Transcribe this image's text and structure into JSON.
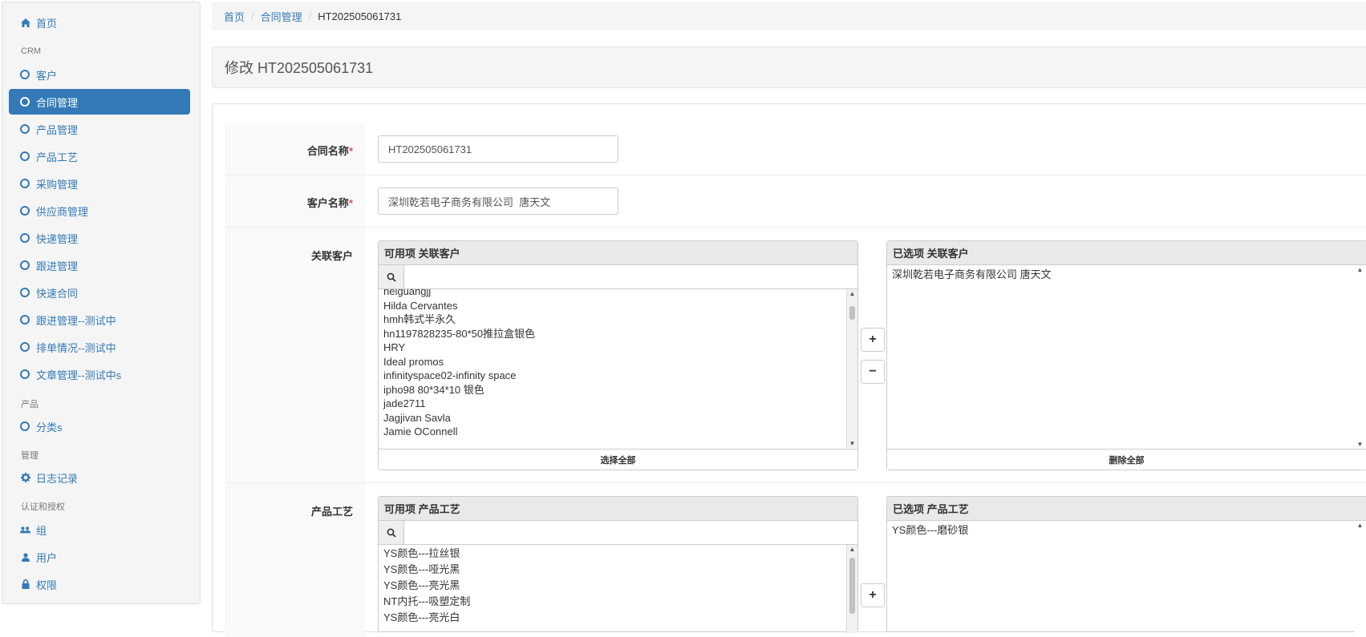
{
  "sidebar": {
    "items": [
      {
        "label": "首页",
        "icon": "home-icon"
      },
      {
        "label": "客户",
        "icon": "circle-o-icon"
      },
      {
        "label": "合同管理",
        "icon": "circle-o-icon"
      },
      {
        "label": "产品管理",
        "icon": "circle-o-icon"
      },
      {
        "label": "产品工艺",
        "icon": "circle-o-icon"
      },
      {
        "label": "采购管理",
        "icon": "circle-o-icon"
      },
      {
        "label": "供应商管理",
        "icon": "circle-o-icon"
      },
      {
        "label": "快递管理",
        "icon": "circle-o-icon"
      },
      {
        "label": "跟进管理",
        "icon": "circle-o-icon"
      },
      {
        "label": "快速合同",
        "icon": "circle-o-icon"
      },
      {
        "label": "跟进管理--测试中",
        "icon": "circle-o-icon"
      },
      {
        "label": "排单情况--测试中",
        "icon": "circle-o-icon"
      },
      {
        "label": "文章管理--测试中s",
        "icon": "circle-o-icon"
      },
      {
        "label": "分类s",
        "icon": "circle-o-icon"
      },
      {
        "label": "日志记录",
        "icon": "gear-icon"
      },
      {
        "label": "组",
        "icon": "users-icon"
      },
      {
        "label": "用户",
        "icon": "user-icon"
      },
      {
        "label": "权限",
        "icon": "lock-icon"
      }
    ],
    "headers": [
      "CRM",
      "产品",
      "管理",
      "认证和授权"
    ],
    "active_item": "合同管理"
  },
  "breadcrumb": {
    "home": "首页",
    "section": "合同管理",
    "current": "HT202505061731"
  },
  "page_title": "修改 HT202505061731",
  "form": {
    "contract_name_label": "合同名称",
    "contract_name_value": "HT202505061731",
    "customer_name_label": "客户名称",
    "customer_name_value": "深圳乾若电子商务有限公司  唐天文",
    "related_label": "关联客户",
    "craft_label": "产品工艺",
    "required_mark": "*"
  },
  "related_customers": {
    "available_header": "可用项 关联客户",
    "selected_header": "已选项 关联客户",
    "available_items": [
      "heiguangjj",
      "Hilda Cervantes",
      "hmh韩式半永久",
      "hn1197828235-80*50推拉盒银色",
      "HRY",
      "Ideal promos",
      "infinityspace02-infinity space",
      "ipho98 80*34*10 银色",
      "jade2711",
      "Jagjivan Savla",
      "Jamie OConnell"
    ],
    "selected_items": [
      "深圳乾若电子商务有限公司 唐天文"
    ],
    "select_all": "选择全部",
    "remove_all": "删除全部"
  },
  "product_craft": {
    "available_header": "可用项 产品工艺",
    "selected_header": "已选项 产品工艺",
    "available_items": [
      "YS颜色---拉丝银",
      "YS颜色---哑光黑",
      "YS颜色---亮光黑",
      "NT内托---吸塑定制",
      "YS颜色---亮光白"
    ],
    "selected_items": [
      "YS颜色---磨砂银"
    ]
  },
  "buttons": {
    "add": "+",
    "remove": "−"
  },
  "colors": {
    "accent": "#337ab7",
    "required": "#d9534f"
  }
}
